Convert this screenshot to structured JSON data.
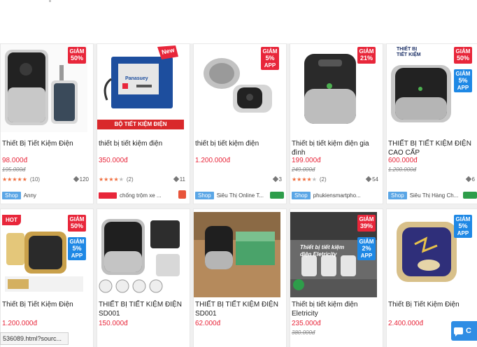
{
  "products": [
    {
      "title": "Thiết Bị Tiết Kiệm Điện",
      "price": "98.000đ",
      "old_price": "195.000đ",
      "rating_count": "(10)",
      "tag_count": "120",
      "shop_tag": "Shop",
      "shop_name": "Anny",
      "badges": [
        {
          "line1": "GIẢM",
          "line2": "50%",
          "color": "red"
        }
      ]
    },
    {
      "title": "thiết bị tiết kiệm điện",
      "price": "350.000đ",
      "rating_count": "(2)",
      "tag_count": "11",
      "shop_name": "chống trộm xe ...",
      "image_text": "BỘ TIẾT KIỆM ĐIỆN",
      "image_brand": "Panasuey",
      "image_new": "New"
    },
    {
      "title": "thiết bị tiết kiệm điện",
      "price": "1.200.000đ",
      "tag_count": "3",
      "shop_tag": "Shop",
      "shop_name": "Siêu Thị Online T...",
      "badges": [
        {
          "line1": "GIẢM",
          "line2": "5%",
          "line3": "APP",
          "color": "red"
        }
      ]
    },
    {
      "title": "Thiết bị tiết kiệm điện gia đình",
      "price": "199.000đ",
      "old_price": "249.000đ",
      "rating_count": "(2)",
      "tag_count": "54",
      "shop_tag": "Shop",
      "shop_name": "phukiensmartpho...",
      "badges": [
        {
          "line1": "GIẢM",
          "line2": "21%",
          "color": "red"
        }
      ]
    },
    {
      "title": "THIẾT BỊ TIẾT KIỆM ĐIỆN CAO CẤP",
      "price": "600.000đ",
      "old_price": "1.200.000đ",
      "tag_count": "6",
      "shop_tag": "Shop",
      "shop_name": "Siêu Thị Hàng Ch...",
      "image_text": "THIẾT BỊ TIẾT KIỆM",
      "badges": [
        {
          "line1": "GIẢM",
          "line2": "50%",
          "color": "red"
        },
        {
          "line1": "GIẢM",
          "line2": "5%",
          "line3": "APP",
          "color": "blue"
        }
      ]
    },
    {
      "title": "Thiết Bị Tiết Kiệm Điện",
      "price": "1.200.000đ",
      "hot": "HOT",
      "badges": [
        {
          "line1": "GIẢM",
          "line2": "50%",
          "color": "red"
        },
        {
          "line1": "GIẢM",
          "line2": "5%",
          "line3": "APP",
          "color": "blue"
        }
      ]
    },
    {
      "title": "THIẾT BỊ TIẾT KIỆM ĐIỆN SD001",
      "price": "150.000đ"
    },
    {
      "title": "THIẾT BỊ TIẾT KIỆM ĐIỆN SD001",
      "price": "62.000đ"
    },
    {
      "title": "Thiết bị tiết kiệm điện Eletricity",
      "price": "235.000đ",
      "old_price": "380.000đ",
      "image_text": "Thiết bị tiết kiệm điện Eletricity",
      "badges": [
        {
          "line1": "GIẢM",
          "line2": "39%",
          "color": "red"
        },
        {
          "line1": "GIẢM",
          "line2": "2%",
          "line3": "APP",
          "color": "blue"
        }
      ]
    },
    {
      "title": "Thiết Bị Tiết Kiệm Điện",
      "price": "2.400.000đ",
      "badges": [
        {
          "line1": "GIẢM",
          "line2": "5%",
          "line3": "APP",
          "color": "blue"
        }
      ]
    }
  ],
  "status_url": "536089.html?sourc...",
  "chat_label": "C",
  "colors": {
    "accent": "#e8263a",
    "shop_tag": "#5aa6e6",
    "chat": "#2f8de4"
  }
}
